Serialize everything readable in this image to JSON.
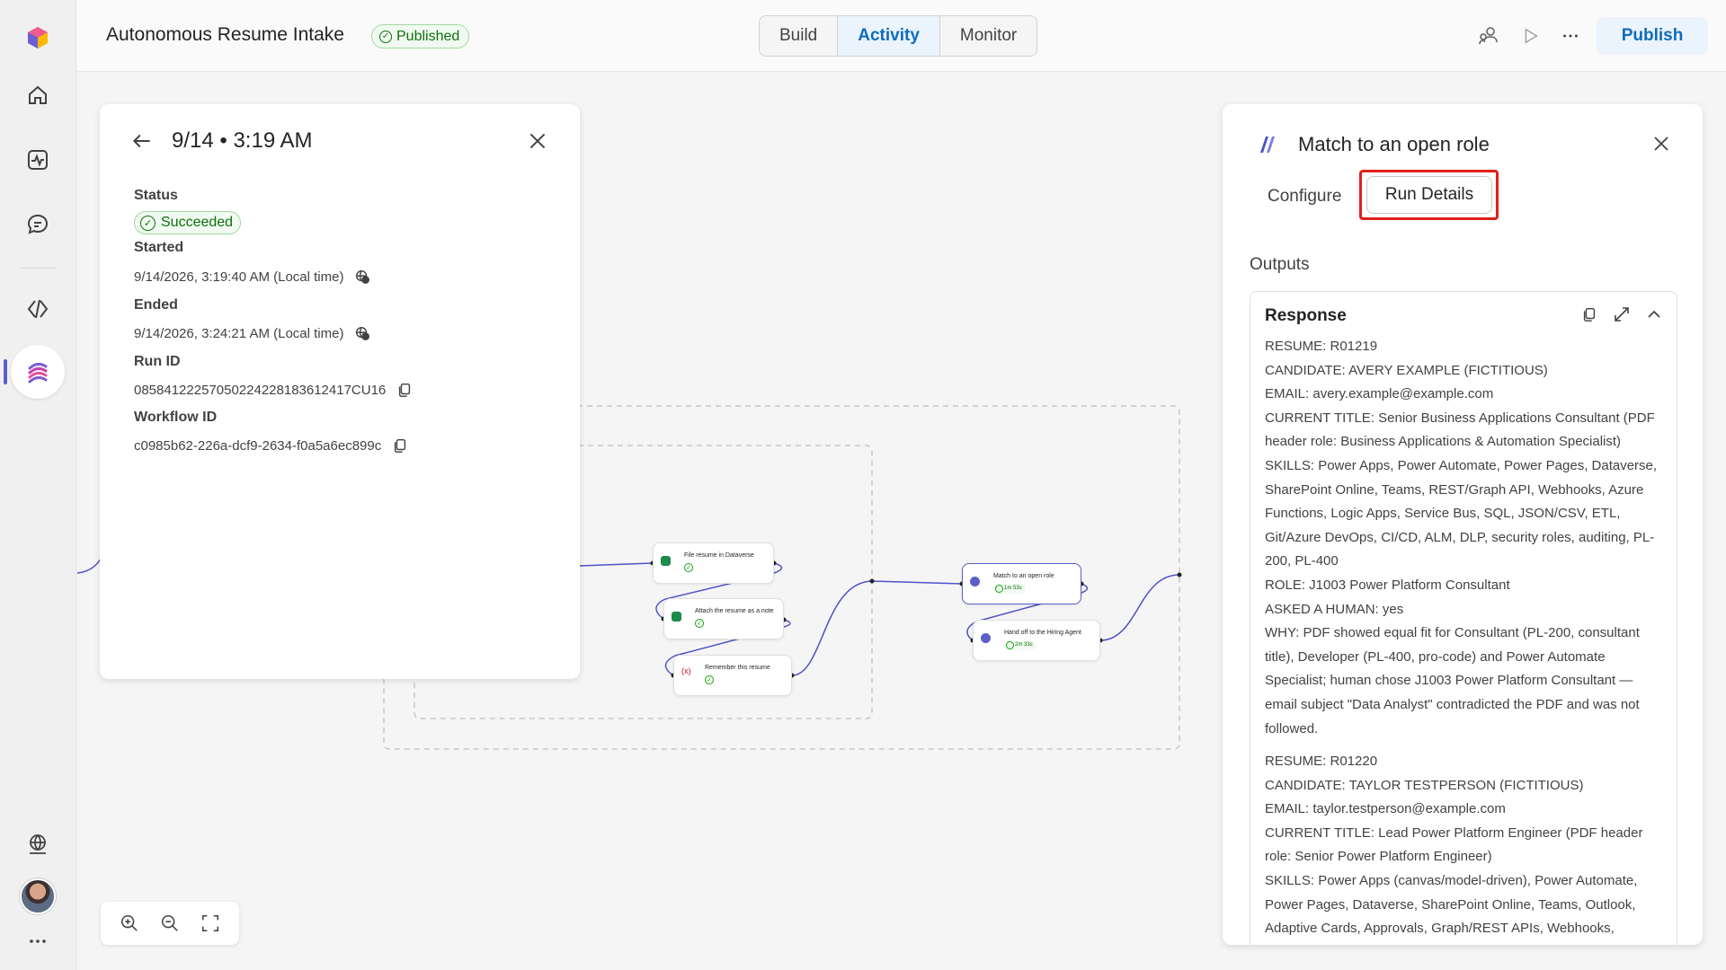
{
  "header": {
    "title": "Autonomous Resume Intake",
    "badge": "Published",
    "tabs": [
      {
        "label": "Build"
      },
      {
        "label": "Activity"
      },
      {
        "label": "Monitor"
      }
    ],
    "publish_label": "Publish"
  },
  "run": {
    "title": "9/14 • 3:19 AM",
    "status_label": "Status",
    "status_value": "Succeeded",
    "started_label": "Started",
    "started_value": "9/14/2026, 3:19:40 AM (Local time)",
    "ended_label": "Ended",
    "ended_value": "9/14/2026, 3:24:21 AM (Local time)",
    "run_id_label": "Run ID",
    "run_id_value": "08584122257050224228183612417CU16",
    "workflow_id_label": "Workflow ID",
    "workflow_id_value": "c0985b62-226a-dcf9-2634-f0a5a6ec899c"
  },
  "flow": {
    "nodes": [
      {
        "label": "File resume in Dataverse"
      },
      {
        "label": "Attach the resume as a note"
      },
      {
        "label": "Remember this resume"
      },
      {
        "label": "Match to an open role",
        "time": "1m 53s"
      },
      {
        "label": "Hand off to the Hiring Agent",
        "time": "2m 33s"
      }
    ]
  },
  "detail": {
    "title": "Match to an open role",
    "tab_configure": "Configure",
    "tab_run_details": "Run Details",
    "outputs_label": "Outputs",
    "response_title": "Response",
    "lines": [
      "RESUME: R01219",
      "CANDIDATE: AVERY EXAMPLE (FICTITIOUS)",
      "EMAIL: avery.example@example.com",
      "CURRENT TITLE: Senior Business Applications Consultant (PDF header role: Business Applications & Automation Specialist)",
      "SKILLS: Power Apps, Power Automate, Power Pages, Dataverse, SharePoint Online, Teams, REST/Graph API, Webhooks, Azure Functions, Logic Apps, Service Bus, SQL, JSON/CSV, ETL, Git/Azure DevOps, CI/CD, ALM, DLP, security roles, auditing, PL-200, PL-400",
      "ROLE: J1003 Power Platform Consultant",
      "ASKED A HUMAN: yes",
      "WHY: PDF showed equal fit for Consultant (PL-200, consultant title), Developer (PL-400, pro-code) and Power Automate Specialist; human chose J1003 Power Platform Consultant — email subject \"Data Analyst\" contradicted the PDF and was not followed.",
      "RESUME: R01220",
      "CANDIDATE: TAYLOR TESTPERSON (FICTITIOUS)",
      "EMAIL: taylor.testperson@example.com",
      "CURRENT TITLE: Lead Power Platform Engineer (PDF header role: Senior Power Platform Engineer)",
      "SKILLS: Power Apps (canvas/model-driven), Power Automate, Power Pages, Dataverse, SharePoint Online, Teams, Outlook, Adaptive Cards, Approvals, Graph/REST APIs, Webhooks,"
    ]
  },
  "colors": {
    "accent": "#0f6cbd",
    "success": "#0e700e",
    "highlight": "#e0201a",
    "connector": "#4f52c7"
  }
}
